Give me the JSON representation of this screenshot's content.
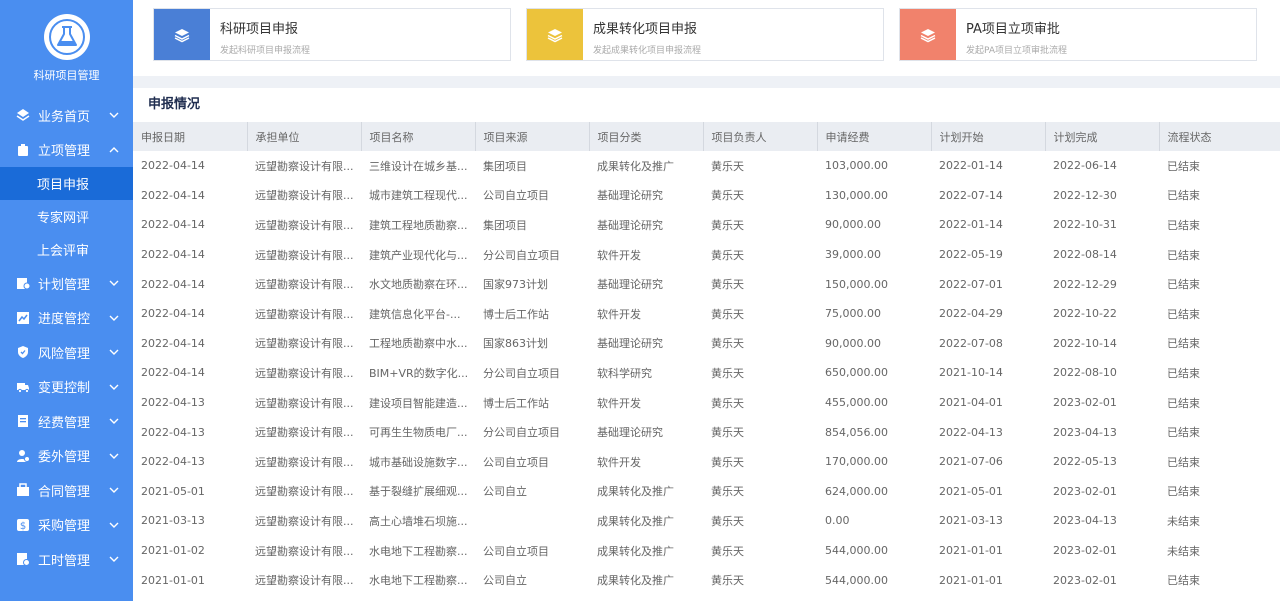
{
  "app": {
    "logo_text": "科研项目管理"
  },
  "sidebar": {
    "items": [
      {
        "label": "业务首页",
        "icon": "home-icon"
      },
      {
        "label": "立项管理",
        "icon": "folder-icon",
        "expanded": true,
        "children": [
          {
            "label": "项目申报",
            "active": true
          },
          {
            "label": "专家网评"
          },
          {
            "label": "上会评审"
          }
        ]
      },
      {
        "label": "计划管理",
        "icon": "plan-icon"
      },
      {
        "label": "进度管控",
        "icon": "progress-icon"
      },
      {
        "label": "风险管理",
        "icon": "shield-icon"
      },
      {
        "label": "变更控制",
        "icon": "truck-icon"
      },
      {
        "label": "经费管理",
        "icon": "funds-icon"
      },
      {
        "label": "委外管理",
        "icon": "user-icon"
      },
      {
        "label": "合同管理",
        "icon": "contract-icon"
      },
      {
        "label": "采购管理",
        "icon": "purchase-icon"
      },
      {
        "label": "工时管理",
        "icon": "clock-icon"
      }
    ]
  },
  "cards": [
    {
      "title": "科研项目申报",
      "subtitle": "发起科研项目申报流程",
      "color": "#4a7fd6"
    },
    {
      "title": "成果转化项目申报",
      "subtitle": "发起成果转化项目申报流程",
      "color": "#ecc33b"
    },
    {
      "title": "PA项目立项审批",
      "subtitle": "发起PA项目立项审批流程",
      "color": "#f1826c"
    }
  ],
  "panel": {
    "title": "申报情况"
  },
  "table": {
    "columns": [
      "申报日期",
      "承担单位",
      "项目名称",
      "项目来源",
      "项目分类",
      "项目负责人",
      "申请经费",
      "计划开始",
      "计划完成",
      "流程状态"
    ],
    "rows": [
      [
        "2022-04-14",
        "远望勘察设计有限...",
        "三维设计在城乡基...",
        "集团项目",
        "成果转化及推广",
        "黄乐天",
        "103,000.00",
        "2022-01-14",
        "2022-06-14",
        "已结束"
      ],
      [
        "2022-04-14",
        "远望勘察设计有限...",
        "城市建筑工程现代...",
        "公司自立项目",
        "基础理论研究",
        "黄乐天",
        "130,000.00",
        "2022-07-14",
        "2022-12-30",
        "已结束"
      ],
      [
        "2022-04-14",
        "远望勘察设计有限...",
        "建筑工程地质勘察...",
        "集团项目",
        "基础理论研究",
        "黄乐天",
        "90,000.00",
        "2022-01-14",
        "2022-10-31",
        "已结束"
      ],
      [
        "2022-04-14",
        "远望勘察设计有限...",
        "建筑产业现代化与...",
        "分公司自立项目",
        "软件开发",
        "黄乐天",
        "39,000.00",
        "2022-05-19",
        "2022-08-14",
        "已结束"
      ],
      [
        "2022-04-14",
        "远望勘察设计有限...",
        "水文地质勘察在环...",
        "国家973计划",
        "基础理论研究",
        "黄乐天",
        "150,000.00",
        "2022-07-01",
        "2022-12-29",
        "已结束"
      ],
      [
        "2022-04-14",
        "远望勘察设计有限...",
        "建筑信息化平台-...",
        "博士后工作站",
        "软件开发",
        "黄乐天",
        "75,000.00",
        "2022-04-29",
        "2022-10-22",
        "已结束"
      ],
      [
        "2022-04-14",
        "远望勘察设计有限...",
        "工程地质勘察中水...",
        "国家863计划",
        "基础理论研究",
        "黄乐天",
        "90,000.00",
        "2022-07-08",
        "2022-10-14",
        "已结束"
      ],
      [
        "2022-04-14",
        "远望勘察设计有限...",
        "BIM+VR的数字化...",
        "分公司自立项目",
        "软科学研究",
        "黄乐天",
        "650,000.00",
        "2021-10-14",
        "2022-08-10",
        "已结束"
      ],
      [
        "2022-04-13",
        "远望勘察设计有限...",
        "建设项目智能建造...",
        "博士后工作站",
        "软件开发",
        "黄乐天",
        "455,000.00",
        "2021-04-01",
        "2023-02-01",
        "已结束"
      ],
      [
        "2022-04-13",
        "远望勘察设计有限...",
        "可再生生物质电厂...",
        "分公司自立项目",
        "基础理论研究",
        "黄乐天",
        "854,056.00",
        "2022-04-13",
        "2023-04-13",
        "已结束"
      ],
      [
        "2022-04-13",
        "远望勘察设计有限...",
        "城市基础设施数字...",
        "公司自立项目",
        "软件开发",
        "黄乐天",
        "170,000.00",
        "2021-07-06",
        "2022-05-13",
        "已结束"
      ],
      [
        "2021-05-01",
        "远望勘察设计有限...",
        "基于裂缝扩展细观...",
        "公司自立",
        "成果转化及推广",
        "黄乐天",
        "624,000.00",
        "2021-05-01",
        "2023-02-01",
        "已结束"
      ],
      [
        "2021-03-13",
        "远望勘察设计有限...",
        "高土心墙堆石坝施...",
        "",
        "成果转化及推广",
        "黄乐天",
        "0.00",
        "2021-03-13",
        "2023-04-13",
        "未结束"
      ],
      [
        "2021-01-02",
        "远望勘察设计有限...",
        "水电地下工程勘察...",
        "公司自立项目",
        "成果转化及推广",
        "黄乐天",
        "544,000.00",
        "2021-01-01",
        "2023-02-01",
        "未结束"
      ],
      [
        "2021-01-01",
        "远望勘察设计有限...",
        "水电地下工程勘察...",
        "公司自立",
        "成果转化及推广",
        "黄乐天",
        "544,000.00",
        "2021-01-01",
        "2023-02-01",
        "已结束"
      ]
    ]
  }
}
